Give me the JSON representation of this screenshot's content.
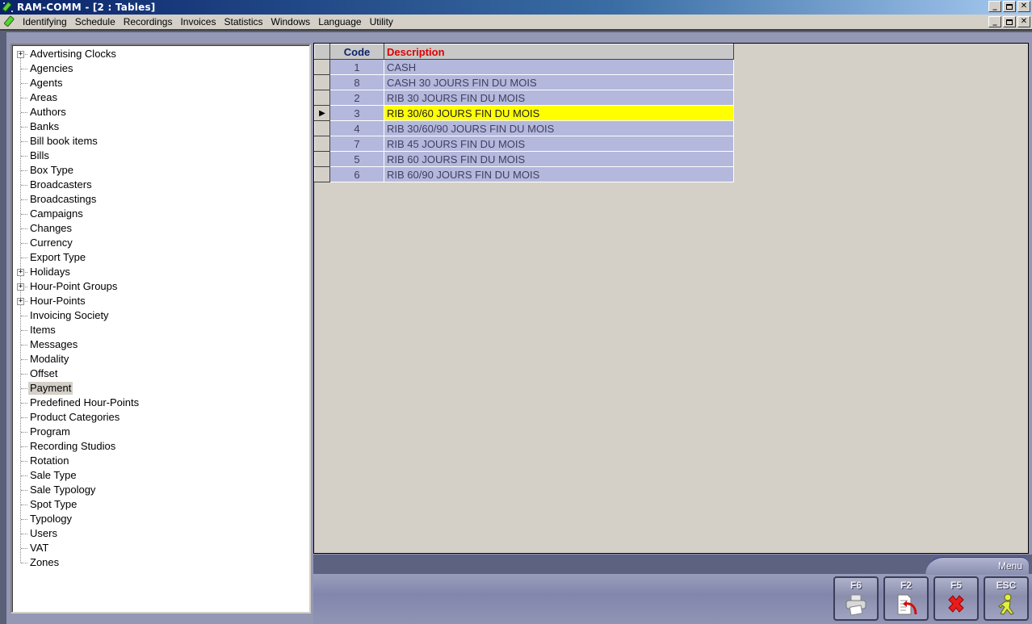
{
  "window": {
    "title": "RAM-COMM - [2 : Tables]",
    "controls": {
      "minimize": "_",
      "restore": "🗗",
      "close": "✕"
    }
  },
  "menubar": {
    "items": [
      "Identifying",
      "Schedule",
      "Recordings",
      "Invoices",
      "Statistics",
      "Windows",
      "Language",
      "Utility"
    ]
  },
  "tree": {
    "selected": "Payment",
    "items": [
      {
        "label": "Advertising Clocks",
        "expandable": true
      },
      {
        "label": "Agencies",
        "expandable": false
      },
      {
        "label": "Agents",
        "expandable": false
      },
      {
        "label": "Areas",
        "expandable": false
      },
      {
        "label": "Authors",
        "expandable": false
      },
      {
        "label": "Banks",
        "expandable": false
      },
      {
        "label": "Bill book items",
        "expandable": false
      },
      {
        "label": "Bills",
        "expandable": false
      },
      {
        "label": "Box Type",
        "expandable": false
      },
      {
        "label": "Broadcasters",
        "expandable": false
      },
      {
        "label": "Broadcastings",
        "expandable": false
      },
      {
        "label": "Campaigns",
        "expandable": false
      },
      {
        "label": "Changes",
        "expandable": false
      },
      {
        "label": "Currency",
        "expandable": false
      },
      {
        "label": "Export Type",
        "expandable": false
      },
      {
        "label": "Holidays",
        "expandable": true
      },
      {
        "label": "Hour-Point Groups",
        "expandable": true
      },
      {
        "label": "Hour-Points",
        "expandable": true
      },
      {
        "label": "Invoicing Society",
        "expandable": false
      },
      {
        "label": "Items",
        "expandable": false
      },
      {
        "label": "Messages",
        "expandable": false
      },
      {
        "label": "Modality",
        "expandable": false
      },
      {
        "label": "Offset",
        "expandable": false
      },
      {
        "label": "Payment",
        "expandable": false
      },
      {
        "label": "Predefined Hour-Points",
        "expandable": false
      },
      {
        "label": "Product Categories",
        "expandable": false
      },
      {
        "label": "Program",
        "expandable": false
      },
      {
        "label": "Recording Studios",
        "expandable": false
      },
      {
        "label": "Rotation",
        "expandable": false
      },
      {
        "label": "Sale Type",
        "expandable": false
      },
      {
        "label": "Sale Typology",
        "expandable": false
      },
      {
        "label": "Spot Type",
        "expandable": false
      },
      {
        "label": "Typology",
        "expandable": false
      },
      {
        "label": "Users",
        "expandable": false
      },
      {
        "label": "VAT",
        "expandable": false
      },
      {
        "label": "Zones",
        "expandable": false
      }
    ]
  },
  "grid": {
    "columns": [
      "Code",
      "Description"
    ],
    "selected_row_index": 3,
    "rows": [
      {
        "code": "1",
        "description": "CASH"
      },
      {
        "code": "8",
        "description": "CASH 30 JOURS FIN DU MOIS"
      },
      {
        "code": "2",
        "description": "RIB 30 JOURS FIN DU MOIS"
      },
      {
        "code": "3",
        "description": "RIB 30/60 JOURS FIN DU MOIS"
      },
      {
        "code": "4",
        "description": "RIB 30/60/90 JOURS FIN DU MOIS"
      },
      {
        "code": "7",
        "description": "RIB 45 JOURS FIN DU MOIS"
      },
      {
        "code": "5",
        "description": "RIB 60 JOURS FIN DU MOIS"
      },
      {
        "code": "6",
        "description": "RIB 60/90 JOURS FIN DU MOIS"
      }
    ],
    "row_indicator": "▶"
  },
  "bottom": {
    "menu_tab": "Menu",
    "buttons": [
      {
        "key": "F6",
        "icon": "printer-icon"
      },
      {
        "key": "F2",
        "icon": "document-undo-icon"
      },
      {
        "key": "F5",
        "icon": "delete-x-icon"
      },
      {
        "key": "ESC",
        "icon": "running-man-exit-icon"
      }
    ]
  },
  "colors": {
    "title_gradient_start": "#0a246a",
    "grid_row_bg": "#b4b8dc",
    "selected_row_bg": "#ffff00",
    "code_header": "#0a246a",
    "description_header": "#e00000"
  }
}
